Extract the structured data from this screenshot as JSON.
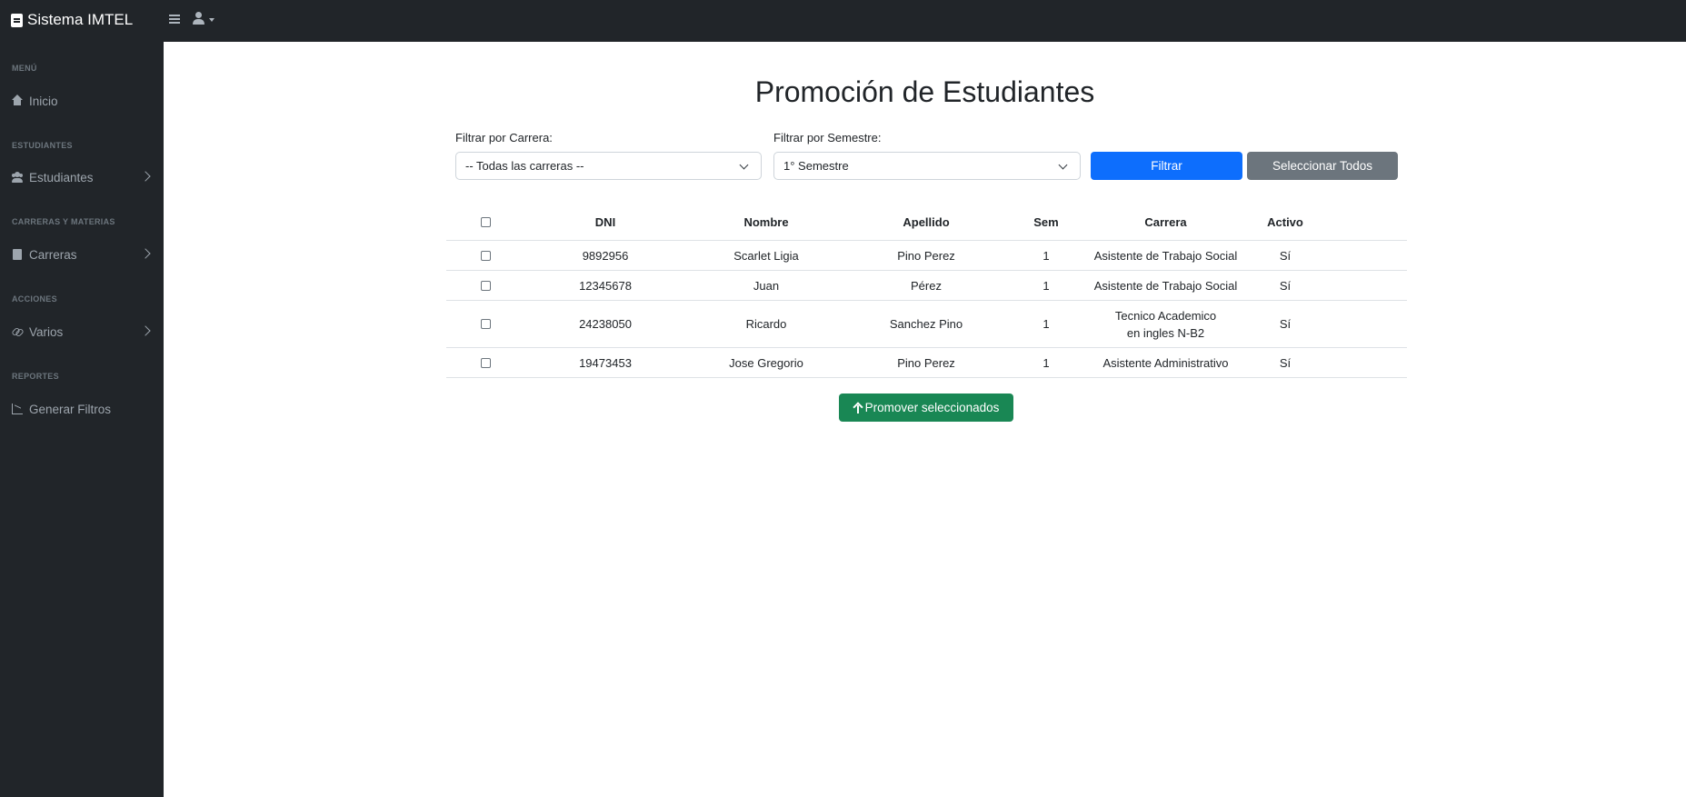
{
  "app": {
    "title": "Sistema IMTEL"
  },
  "sidebar": {
    "sections": [
      {
        "heading": "MENÚ",
        "items": [
          {
            "label": "Inicio",
            "icon": "home-icon",
            "chevron": false
          }
        ]
      },
      {
        "heading": "ESTUDIANTES",
        "items": [
          {
            "label": "Estudiantes",
            "icon": "users-icon",
            "chevron": true
          }
        ]
      },
      {
        "heading": "CARRERAS Y MATERIAS",
        "items": [
          {
            "label": "Carreras",
            "icon": "book-icon",
            "chevron": true
          }
        ]
      },
      {
        "heading": "ACCIONES",
        "items": [
          {
            "label": "Varios",
            "icon": "link-icon",
            "chevron": true
          }
        ]
      },
      {
        "heading": "REPORTES",
        "items": [
          {
            "label": "Generar Filtros",
            "icon": "chart-icon",
            "chevron": false
          }
        ]
      }
    ]
  },
  "page": {
    "title": "Promoción de Estudiantes",
    "filters": {
      "carrera_label": "Filtrar por Carrera:",
      "carrera_value": "-- Todas las carreras --",
      "semestre_label": "Filtrar por Semestre:",
      "semestre_value": "1° Semestre",
      "filter_button": "Filtrar",
      "select_all_button": "Seleccionar Todos"
    },
    "table": {
      "headers": [
        "DNI",
        "Nombre",
        "Apellido",
        "Sem",
        "Carrera",
        "Activo"
      ],
      "rows": [
        {
          "dni": "9892956",
          "nombre": "Scarlet Ligia",
          "apellido": "Pino Perez",
          "sem": "1",
          "carrera": "Asistente de Trabajo Social",
          "activo": "Sí"
        },
        {
          "dni": "12345678",
          "nombre": "Juan",
          "apellido": "Pérez",
          "sem": "1",
          "carrera": "Asistente de Trabajo Social",
          "activo": "Sí"
        },
        {
          "dni": "24238050",
          "nombre": "Ricardo",
          "apellido": "Sanchez Pino",
          "sem": "1",
          "carrera": "Tecnico Academico en ingles N-B2",
          "activo": "Sí"
        },
        {
          "dni": "19473453",
          "nombre": "Jose Gregorio",
          "apellido": "Pino Perez",
          "sem": "1",
          "carrera": "Asistente Administrativo",
          "activo": "Sí"
        }
      ]
    },
    "promote_button": "Promover seleccionados"
  },
  "colors": {
    "sidebar_bg": "#212529",
    "primary": "#0d6efd",
    "secondary": "#6c757d",
    "success": "#198754"
  }
}
